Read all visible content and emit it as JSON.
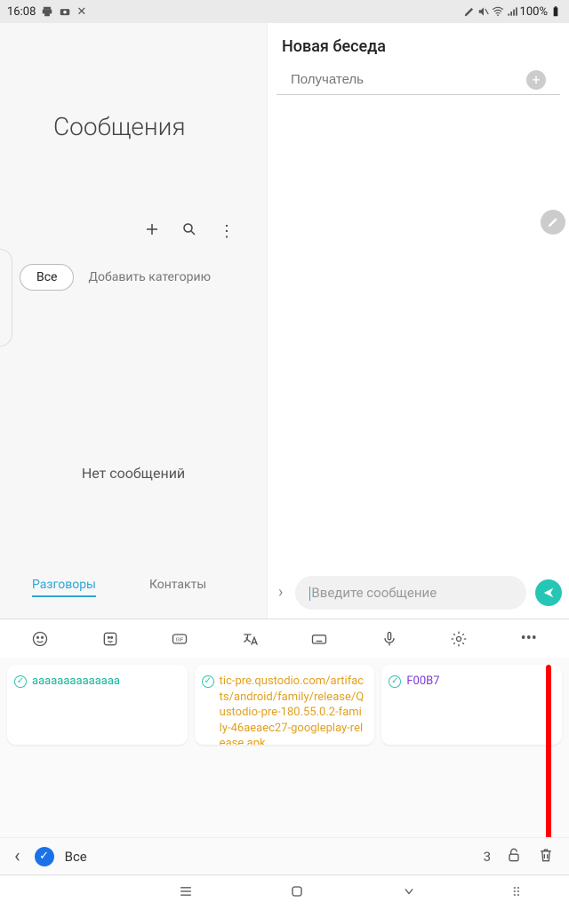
{
  "status": {
    "time": "16:08",
    "battery": "100%"
  },
  "left": {
    "title": "Сообщения",
    "chip_all": "Все",
    "add_category": "Добавить категорию",
    "empty": "Нет сообщений",
    "tab_conversations": "Разговоры",
    "tab_contacts": "Контакты"
  },
  "right": {
    "title": "Новая беседа",
    "recipient_placeholder": "Получатель",
    "message_placeholder": "Введите сообщение"
  },
  "clipboard": {
    "items": [
      "aaaaaaaaaaaaaa",
      "tic-pre.qustodio.com/artifacts/android/family/release/Qustodio-pre-180.55.0.2-family-46aeaec27-googleplay-release.apk",
      "F00B7"
    ],
    "select_all": "Все",
    "selected_count": "3"
  }
}
